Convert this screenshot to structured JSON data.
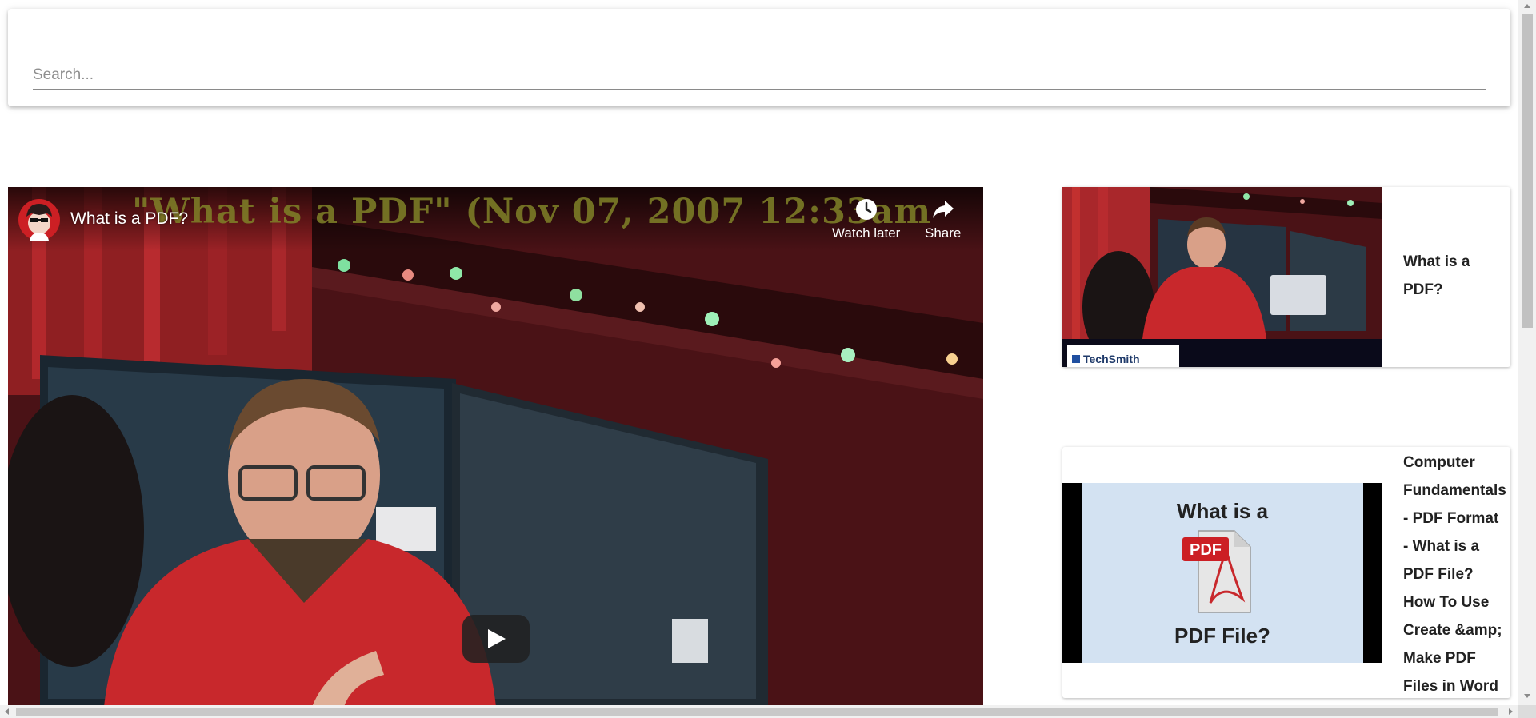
{
  "search": {
    "placeholder": "Search..."
  },
  "player": {
    "title": "What is a PDF?",
    "overlay_caption": "\"What is a PDF\" (Nov 07, 2007 12:33am",
    "watch_later_label": "Watch later",
    "share_label": "Share",
    "icons": {
      "watch_later": "clock-icon",
      "share": "share-arrow-icon",
      "play": "play-icon"
    }
  },
  "related": {
    "items": [
      {
        "title": "What is a PDF?",
        "thumb_caption_brand": "TechSmith"
      },
      {
        "title": "Computer Fundamentals - PDF Format - What is a PDF File? How To Use Create &amp; Make PDF Files in Word",
        "thumb_text_top": "What is a",
        "thumb_badge": "PDF",
        "thumb_text_bottom": "PDF File?"
      }
    ]
  },
  "colors": {
    "accent_red": "#cc1f24",
    "thumb_bg_blue": "#d3e2f2",
    "scene_curtain": "#8f1f22"
  }
}
